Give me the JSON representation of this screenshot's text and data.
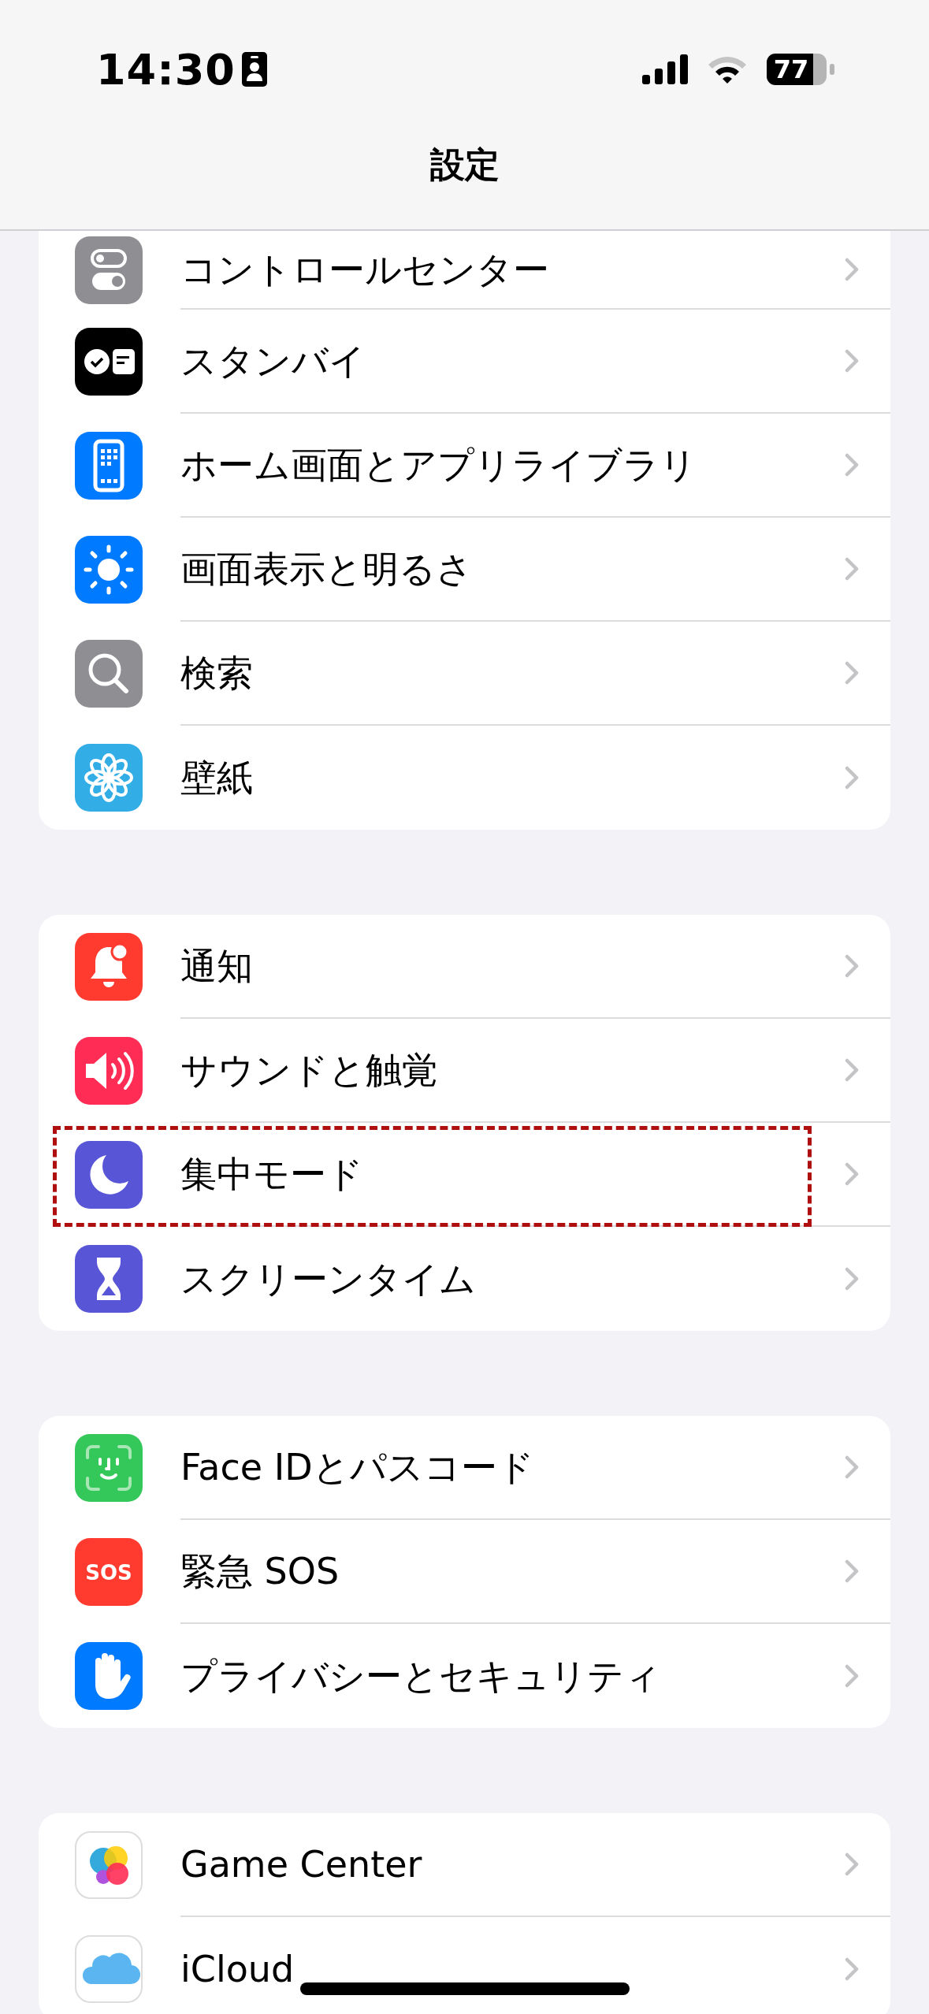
{
  "status_bar": {
    "time": "14:30",
    "battery": "77"
  },
  "title": "設定",
  "groups": [
    {
      "items": [
        {
          "label": "コントロールセンター",
          "highlighted": false
        },
        {
          "label": "スタンバイ",
          "highlighted": false
        },
        {
          "label": "ホーム画面とアプリライブラリ",
          "highlighted": false
        },
        {
          "label": "画面表示と明るさ",
          "highlighted": false
        },
        {
          "label": "検索",
          "highlighted": false
        },
        {
          "label": "壁紙",
          "highlighted": false
        }
      ]
    },
    {
      "items": [
        {
          "label": "通知",
          "highlighted": false
        },
        {
          "label": "サウンドと触覚",
          "highlighted": false
        },
        {
          "label": "集中モード",
          "highlighted": true
        },
        {
          "label": "スクリーンタイム",
          "highlighted": false
        }
      ]
    },
    {
      "items": [
        {
          "label": "Face IDとパスコード",
          "highlighted": false
        },
        {
          "label": "緊急 SOS",
          "icon_text": "SOS",
          "highlighted": false
        },
        {
          "label": "プライバシーとセキュリティ",
          "highlighted": false
        }
      ]
    },
    {
      "items": [
        {
          "label": "Game Center",
          "highlighted": false
        },
        {
          "label": "iCloud",
          "highlighted": false
        }
      ]
    }
  ]
}
